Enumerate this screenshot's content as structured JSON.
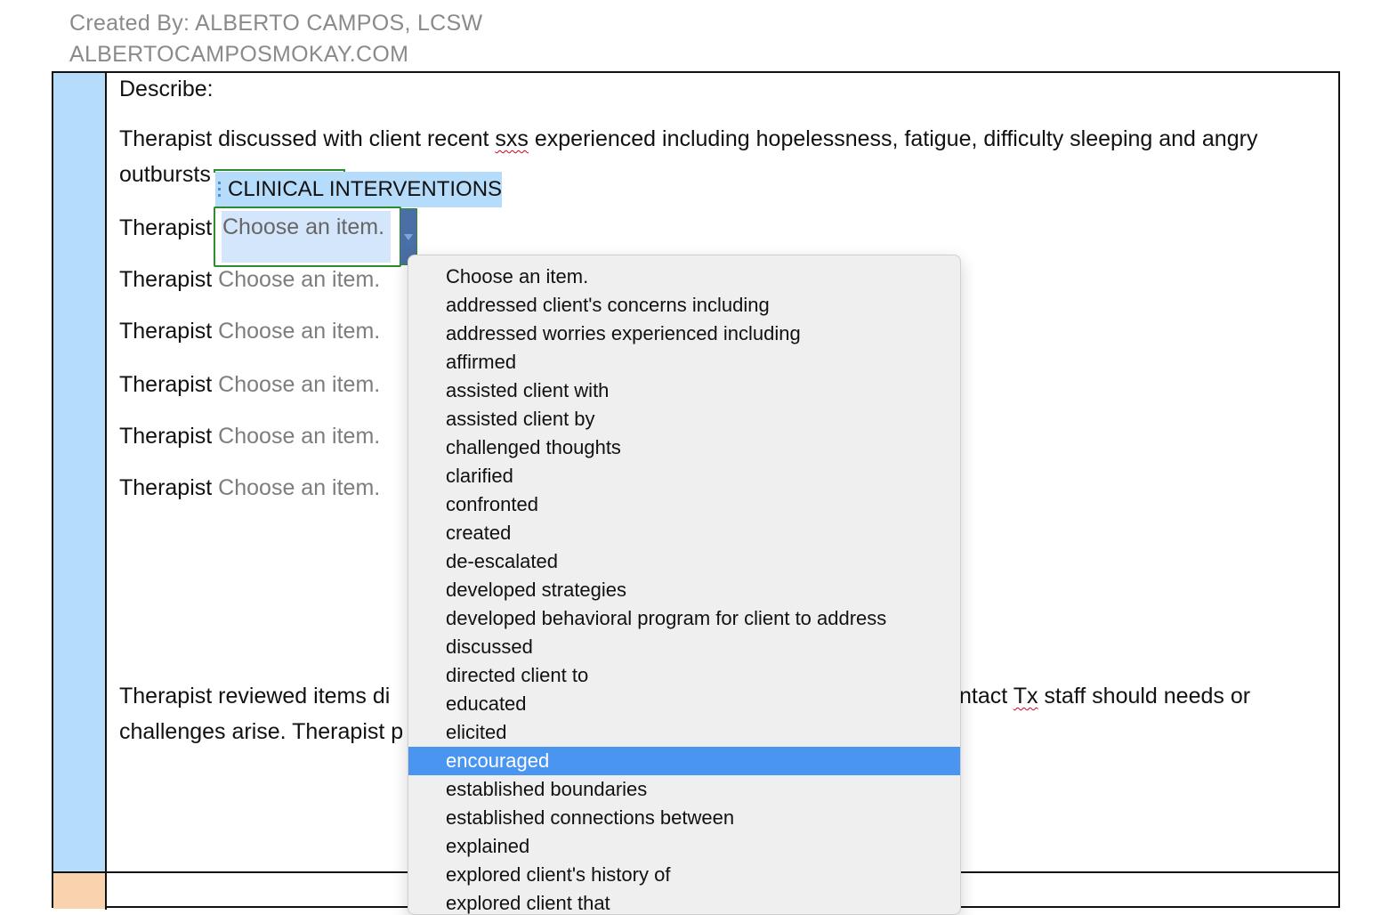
{
  "header": {
    "created_by": "Created By: ALBERTO CAMPOS, LCSW",
    "website": "ALBERTOCAMPOSMOKAY.COM"
  },
  "document": {
    "describe_label": "Describe:",
    "paragraph1_a": "Therapist discussed with client recent ",
    "paragraph1_sxs": "sxs",
    "paragraph1_b": " experienced including hopelessness, fatigue, difficulty sleeping and angry",
    "paragraph1_line2": "outbursts",
    "therapist_label": "Therapist",
    "placeholder": "Choose an item.",
    "paragraph_final_a": "Therapist reviewed items di",
    "paragraph_final_b": "ntact ",
    "paragraph_final_tx": "Tx",
    "paragraph_final_c": " staff should needs or",
    "paragraph_final_line2": "challenges arise. Therapist p"
  },
  "content_control": {
    "title": "CLINICAL INTERVENTIONS",
    "value": "Choose an item."
  },
  "dropdown": {
    "items": [
      "Choose an item.",
      "addressed client's concerns including",
      "addressed worries experienced including",
      "affirmed",
      "assisted client with",
      "assisted client by",
      "challenged thoughts",
      "clarified",
      "confronted",
      "created",
      "de-escalated",
      "developed strategies",
      "developed behavioral program for client to address",
      "discussed",
      "directed client to",
      "educated",
      "elicited",
      "encouraged",
      "established boundaries",
      "established connections between",
      "explained",
      "explored client's history of",
      "explored client that"
    ],
    "highlighted": "encouraged"
  },
  "colors": {
    "side_blue": "#b6dcfb",
    "side_orange": "#f8d3ae",
    "highlight": "#4a95f0"
  }
}
